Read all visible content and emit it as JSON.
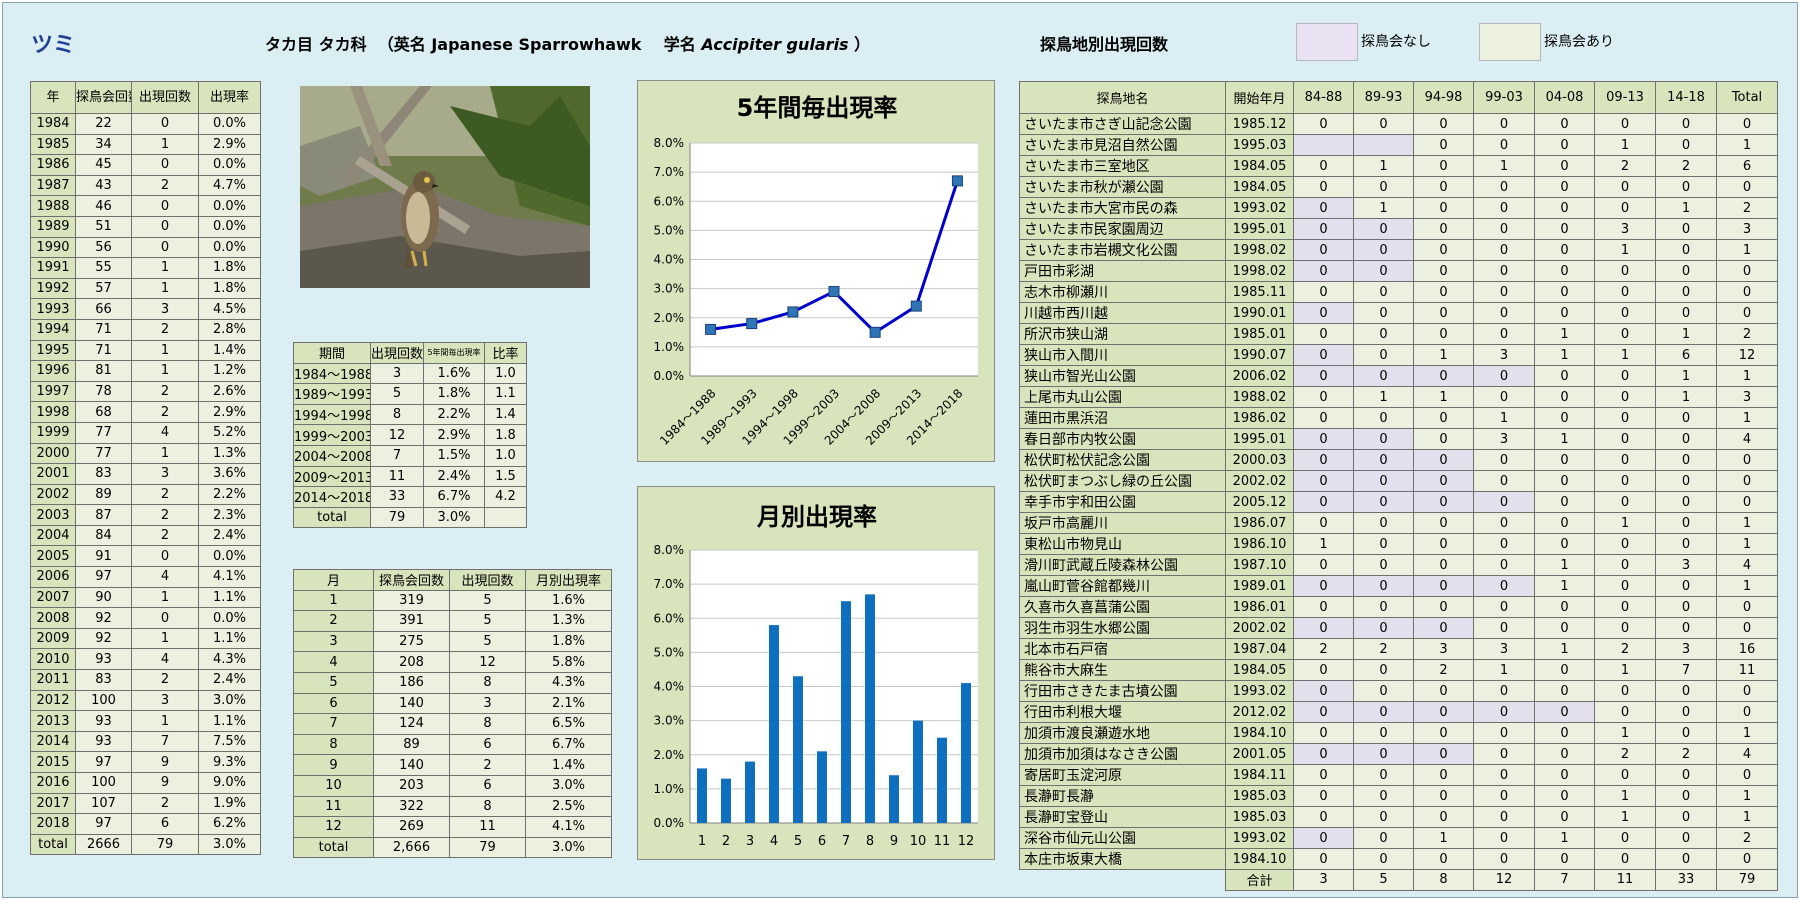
{
  "header": {
    "species": "ツミ",
    "order_family": "タカ目 タカ科",
    "english_prefix": "（英名",
    "english_name": "Japanese Sparrowhawk",
    "sci_prefix": "学名",
    "scientific_name": "Accipiter gularis",
    "close_paren": "）",
    "site_title": "探鳥地別出現回数",
    "legend_no": "探鳥会なし",
    "legend_yes": "探鳥会あり"
  },
  "colors": {
    "sheet_bg": "#daeef3",
    "header_cell": "#d8e4bc",
    "body_cell": "#ebf1de",
    "no_meeting": "#e4dfec",
    "line": "#0000cc",
    "marker": "#2e75b6",
    "bar": "#0f6fbf"
  },
  "year_table": {
    "headers": [
      "年",
      "探鳥会回数",
      "出現回数",
      "出現率"
    ],
    "rows": [
      [
        "1984",
        "22",
        "0",
        "0.0%"
      ],
      [
        "1985",
        "34",
        "1",
        "2.9%"
      ],
      [
        "1986",
        "45",
        "0",
        "0.0%"
      ],
      [
        "1987",
        "43",
        "2",
        "4.7%"
      ],
      [
        "1988",
        "46",
        "0",
        "0.0%"
      ],
      [
        "1989",
        "51",
        "0",
        "0.0%"
      ],
      [
        "1990",
        "56",
        "0",
        "0.0%"
      ],
      [
        "1991",
        "55",
        "1",
        "1.8%"
      ],
      [
        "1992",
        "57",
        "1",
        "1.8%"
      ],
      [
        "1993",
        "66",
        "3",
        "4.5%"
      ],
      [
        "1994",
        "71",
        "2",
        "2.8%"
      ],
      [
        "1995",
        "71",
        "1",
        "1.4%"
      ],
      [
        "1996",
        "81",
        "1",
        "1.2%"
      ],
      [
        "1997",
        "78",
        "2",
        "2.6%"
      ],
      [
        "1998",
        "68",
        "2",
        "2.9%"
      ],
      [
        "1999",
        "77",
        "4",
        "5.2%"
      ],
      [
        "2000",
        "77",
        "1",
        "1.3%"
      ],
      [
        "2001",
        "83",
        "3",
        "3.6%"
      ],
      [
        "2002",
        "89",
        "2",
        "2.2%"
      ],
      [
        "2003",
        "87",
        "2",
        "2.3%"
      ],
      [
        "2004",
        "84",
        "2",
        "2.4%"
      ],
      [
        "2005",
        "91",
        "0",
        "0.0%"
      ],
      [
        "2006",
        "97",
        "4",
        "4.1%"
      ],
      [
        "2007",
        "90",
        "1",
        "1.1%"
      ],
      [
        "2008",
        "92",
        "0",
        "0.0%"
      ],
      [
        "2009",
        "92",
        "1",
        "1.1%"
      ],
      [
        "2010",
        "93",
        "4",
        "4.3%"
      ],
      [
        "2011",
        "83",
        "2",
        "2.4%"
      ],
      [
        "2012",
        "100",
        "3",
        "3.0%"
      ],
      [
        "2013",
        "93",
        "1",
        "1.1%"
      ],
      [
        "2014",
        "93",
        "7",
        "7.5%"
      ],
      [
        "2015",
        "97",
        "9",
        "9.3%"
      ],
      [
        "2016",
        "100",
        "9",
        "9.0%"
      ],
      [
        "2017",
        "107",
        "2",
        "1.9%"
      ],
      [
        "2018",
        "97",
        "6",
        "6.2%"
      ],
      [
        "total",
        "2666",
        "79",
        "3.0%"
      ]
    ]
  },
  "period_table": {
    "headers": [
      "期間",
      "出現回数",
      "5年間毎出現率",
      "比率"
    ],
    "rows": [
      [
        "1984～1988",
        "3",
        "1.6%",
        "1.0"
      ],
      [
        "1989～1993",
        "5",
        "1.8%",
        "1.1"
      ],
      [
        "1994～1998",
        "8",
        "2.2%",
        "1.4"
      ],
      [
        "1999～2003",
        "12",
        "2.9%",
        "1.8"
      ],
      [
        "2004～2008",
        "7",
        "1.5%",
        "1.0"
      ],
      [
        "2009～2013",
        "11",
        "2.4%",
        "1.5"
      ],
      [
        "2014～2018",
        "33",
        "6.7%",
        "4.2"
      ],
      [
        "total",
        "79",
        "3.0%",
        ""
      ]
    ]
  },
  "month_table": {
    "headers": [
      "月",
      "探鳥会回数",
      "出現回数",
      "月別出現率"
    ],
    "rows": [
      [
        "1",
        "319",
        "5",
        "1.6%"
      ],
      [
        "2",
        "391",
        "5",
        "1.3%"
      ],
      [
        "3",
        "275",
        "5",
        "1.8%"
      ],
      [
        "4",
        "208",
        "12",
        "5.8%"
      ],
      [
        "5",
        "186",
        "8",
        "4.3%"
      ],
      [
        "6",
        "140",
        "3",
        "2.1%"
      ],
      [
        "7",
        "124",
        "8",
        "6.5%"
      ],
      [
        "8",
        "89",
        "6",
        "6.7%"
      ],
      [
        "9",
        "140",
        "2",
        "1.4%"
      ],
      [
        "10",
        "203",
        "6",
        "3.0%"
      ],
      [
        "11",
        "322",
        "8",
        "2.5%"
      ],
      [
        "12",
        "269",
        "11",
        "4.1%"
      ],
      [
        "total",
        "2,666",
        "79",
        "3.0%"
      ]
    ]
  },
  "site_table": {
    "headers": [
      "探鳥地名",
      "開始年月",
      "84-88",
      "89-93",
      "94-98",
      "99-03",
      "04-08",
      "09-13",
      "14-18",
      "Total"
    ],
    "rows": [
      {
        "name": "さいたま市さぎ山記念公園",
        "start": "1985.12",
        "v": [
          "0",
          "0",
          "0",
          "0",
          "0",
          "0",
          "0"
        ],
        "none": [],
        "total": "0"
      },
      {
        "name": "さいたま市見沼自然公園",
        "start": "1995.03",
        "v": [
          "",
          "",
          "0",
          "0",
          "0",
          "1",
          "0"
        ],
        "none": [
          0,
          1
        ],
        "total": "1"
      },
      {
        "name": "さいたま市三室地区",
        "start": "1984.05",
        "v": [
          "0",
          "1",
          "0",
          "1",
          "0",
          "2",
          "2"
        ],
        "none": [],
        "total": "6"
      },
      {
        "name": "さいたま市秋が瀬公園",
        "start": "1984.05",
        "v": [
          "0",
          "0",
          "0",
          "0",
          "0",
          "0",
          "0"
        ],
        "none": [],
        "total": "0"
      },
      {
        "name": "さいたま市大宮市民の森",
        "start": "1993.02",
        "v": [
          "0",
          "1",
          "0",
          "0",
          "0",
          "0",
          "1"
        ],
        "none": [
          0
        ],
        "total": "2"
      },
      {
        "name": "さいたま市民家園周辺",
        "start": "1995.01",
        "v": [
          "0",
          "0",
          "0",
          "0",
          "0",
          "3",
          "0"
        ],
        "none": [
          0,
          1
        ],
        "total": "3"
      },
      {
        "name": "さいたま市岩槻文化公園",
        "start": "1998.02",
        "v": [
          "0",
          "0",
          "0",
          "0",
          "0",
          "1",
          "0"
        ],
        "none": [
          0,
          1
        ],
        "total": "1"
      },
      {
        "name": "戸田市彩湖",
        "start": "1998.02",
        "v": [
          "0",
          "0",
          "0",
          "0",
          "0",
          "0",
          "0"
        ],
        "none": [
          0,
          1
        ],
        "total": "0"
      },
      {
        "name": "志木市柳瀬川",
        "start": "1985.11",
        "v": [
          "0",
          "0",
          "0",
          "0",
          "0",
          "0",
          "0"
        ],
        "none": [],
        "total": "0"
      },
      {
        "name": "川越市西川越",
        "start": "1990.01",
        "v": [
          "0",
          "0",
          "0",
          "0",
          "0",
          "0",
          "0"
        ],
        "none": [
          0
        ],
        "total": "0"
      },
      {
        "name": "所沢市狭山湖",
        "start": "1985.01",
        "v": [
          "0",
          "0",
          "0",
          "0",
          "1",
          "0",
          "1"
        ],
        "none": [],
        "total": "2"
      },
      {
        "name": "狭山市入間川",
        "start": "1990.07",
        "v": [
          "0",
          "0",
          "1",
          "3",
          "1",
          "1",
          "6"
        ],
        "none": [
          0
        ],
        "total": "12"
      },
      {
        "name": "狭山市智光山公園",
        "start": "2006.02",
        "v": [
          "0",
          "0",
          "0",
          "0",
          "0",
          "0",
          "1"
        ],
        "none": [
          0,
          1,
          2,
          3
        ],
        "total": "1"
      },
      {
        "name": "上尾市丸山公園",
        "start": "1988.02",
        "v": [
          "0",
          "1",
          "1",
          "0",
          "0",
          "0",
          "1"
        ],
        "none": [],
        "total": "3"
      },
      {
        "name": "蓮田市黒浜沼",
        "start": "1986.02",
        "v": [
          "0",
          "0",
          "0",
          "1",
          "0",
          "0",
          "0"
        ],
        "none": [],
        "total": "1"
      },
      {
        "name": "春日部市内牧公園",
        "start": "1995.01",
        "v": [
          "0",
          "0",
          "0",
          "3",
          "1",
          "0",
          "0"
        ],
        "none": [
          0,
          1
        ],
        "total": "4"
      },
      {
        "name": "松伏町松伏記念公園",
        "start": "2000.03",
        "v": [
          "0",
          "0",
          "0",
          "0",
          "0",
          "0",
          "0"
        ],
        "none": [
          0,
          1,
          2
        ],
        "total": "0"
      },
      {
        "name": "松伏町まつぶし緑の丘公園",
        "start": "2002.02",
        "v": [
          "0",
          "0",
          "0",
          "0",
          "0",
          "0",
          "0"
        ],
        "none": [
          0,
          1,
          2
        ],
        "total": "0"
      },
      {
        "name": "幸手市宇和田公園",
        "start": "2005.12",
        "v": [
          "0",
          "0",
          "0",
          "0",
          "0",
          "0",
          "0"
        ],
        "none": [
          0,
          1,
          2,
          3
        ],
        "total": "0"
      },
      {
        "name": "坂戸市高麗川",
        "start": "1986.07",
        "v": [
          "0",
          "0",
          "0",
          "0",
          "0",
          "1",
          "0"
        ],
        "none": [],
        "total": "1"
      },
      {
        "name": "東松山市物見山",
        "start": "1986.10",
        "v": [
          "1",
          "0",
          "0",
          "0",
          "0",
          "0",
          "0"
        ],
        "none": [],
        "total": "1"
      },
      {
        "name": "滑川町武蔵丘陵森林公園",
        "start": "1987.10",
        "v": [
          "0",
          "0",
          "0",
          "0",
          "1",
          "0",
          "3"
        ],
        "none": [],
        "total": "4"
      },
      {
        "name": "嵐山町菅谷館都幾川",
        "start": "1989.01",
        "v": [
          "0",
          "0",
          "0",
          "0",
          "1",
          "0",
          "0"
        ],
        "none": [
          0,
          1,
          2,
          3
        ],
        "total": "1"
      },
      {
        "name": "久喜市久喜菖蒲公園",
        "start": "1986.01",
        "v": [
          "0",
          "0",
          "0",
          "0",
          "0",
          "0",
          "0"
        ],
        "none": [],
        "total": "0"
      },
      {
        "name": "羽生市羽生水郷公園",
        "start": "2002.02",
        "v": [
          "0",
          "0",
          "0",
          "0",
          "0",
          "0",
          "0"
        ],
        "none": [
          0,
          1,
          2
        ],
        "total": "0"
      },
      {
        "name": "北本市石戸宿",
        "start": "1987.04",
        "v": [
          "2",
          "2",
          "3",
          "3",
          "1",
          "2",
          "3"
        ],
        "none": [],
        "total": "16"
      },
      {
        "name": "熊谷市大麻生",
        "start": "1984.05",
        "v": [
          "0",
          "0",
          "2",
          "1",
          "0",
          "1",
          "7"
        ],
        "none": [],
        "total": "11"
      },
      {
        "name": "行田市さきたま古墳公園",
        "start": "1993.02",
        "v": [
          "0",
          "0",
          "0",
          "0",
          "0",
          "0",
          "0"
        ],
        "none": [
          0
        ],
        "total": "0"
      },
      {
        "name": "行田市利根大堰",
        "start": "2012.02",
        "v": [
          "0",
          "0",
          "0",
          "0",
          "0",
          "0",
          "0"
        ],
        "none": [
          0,
          1,
          2,
          3,
          4
        ],
        "total": "0"
      },
      {
        "name": "加須市渡良瀬遊水地",
        "start": "1984.10",
        "v": [
          "0",
          "0",
          "0",
          "0",
          "0",
          "1",
          "0"
        ],
        "none": [],
        "total": "1"
      },
      {
        "name": "加須市加須はなさき公園",
        "start": "2001.05",
        "v": [
          "0",
          "0",
          "0",
          "0",
          "0",
          "2",
          "2"
        ],
        "none": [
          0,
          1,
          2
        ],
        "total": "4"
      },
      {
        "name": "寄居町玉淀河原",
        "start": "1984.11",
        "v": [
          "0",
          "0",
          "0",
          "0",
          "0",
          "0",
          "0"
        ],
        "none": [],
        "total": "0"
      },
      {
        "name": "長瀞町長瀞",
        "start": "1985.03",
        "v": [
          "0",
          "0",
          "0",
          "0",
          "0",
          "1",
          "0"
        ],
        "none": [],
        "total": "1"
      },
      {
        "name": "長瀞町宝登山",
        "start": "1985.03",
        "v": [
          "0",
          "0",
          "0",
          "0",
          "0",
          "1",
          "0"
        ],
        "none": [],
        "total": "1"
      },
      {
        "name": "深谷市仙元山公園",
        "start": "1993.02",
        "v": [
          "0",
          "0",
          "1",
          "0",
          "1",
          "0",
          "0"
        ],
        "none": [
          0
        ],
        "total": "2"
      },
      {
        "name": "本庄市坂東大橋",
        "start": "1984.10",
        "v": [
          "0",
          "0",
          "0",
          "0",
          "0",
          "0",
          "0"
        ],
        "none": [],
        "total": "0"
      }
    ],
    "total_label": "合計",
    "totals": [
      "3",
      "5",
      "8",
      "12",
      "7",
      "11",
      "33",
      "79"
    ]
  },
  "chart_data": [
    {
      "type": "line",
      "title": "5年間毎出現率",
      "categories": [
        "1984～1988",
        "1989～1993",
        "1994～1998",
        "1999～2003",
        "2004～2008",
        "2009～2013",
        "2014～2018"
      ],
      "values": [
        1.6,
        1.8,
        2.2,
        2.9,
        1.5,
        2.4,
        6.7
      ],
      "unit": "%",
      "ylim": [
        0,
        8
      ],
      "yticks": [
        "0.0%",
        "1.0%",
        "2.0%",
        "3.0%",
        "4.0%",
        "5.0%",
        "6.0%",
        "7.0%",
        "8.0%"
      ],
      "grid": true
    },
    {
      "type": "bar",
      "title": "月別出現率",
      "categories": [
        "1",
        "2",
        "3",
        "4",
        "5",
        "6",
        "7",
        "8",
        "9",
        "10",
        "11",
        "12"
      ],
      "values": [
        1.6,
        1.3,
        1.8,
        5.8,
        4.3,
        2.1,
        6.5,
        6.7,
        1.4,
        3.0,
        2.5,
        4.1
      ],
      "unit": "%",
      "ylim": [
        0,
        8
      ],
      "yticks": [
        "0.0%",
        "1.0%",
        "2.0%",
        "3.0%",
        "4.0%",
        "5.0%",
        "6.0%",
        "7.0%",
        "8.0%"
      ],
      "grid": true
    }
  ]
}
